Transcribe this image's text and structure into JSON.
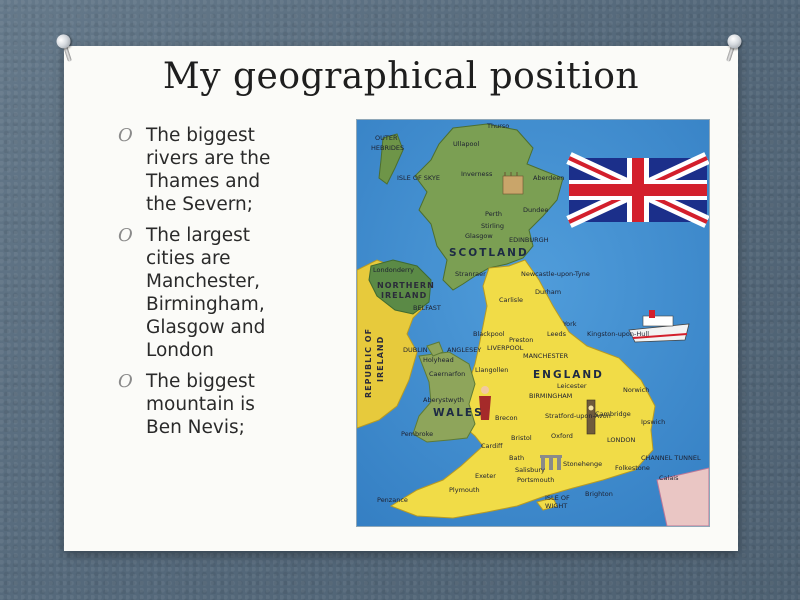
{
  "slide": {
    "title": "My geographical position",
    "bullets": [
      {
        "marker": "O",
        "text": "The biggest rivers are the Thames and the Severn;"
      },
      {
        "marker": "O",
        "text": "The largest cities are Manchester, Birmingham, Glasgow and London"
      },
      {
        "marker": "O",
        "text": "The biggest mountain is Ben Nevis;"
      }
    ]
  },
  "map": {
    "regions": {
      "scotland": "SCOTLAND",
      "england": "ENGLAND",
      "wales": "WALES",
      "northern_ireland_1": "NORTHERN",
      "northern_ireland_2": "IRELAND",
      "republic_1": "REPUBLIC OF",
      "republic_2": "IRELAND"
    },
    "places": {
      "thurso": "Thurso",
      "ullapool": "Ullapool",
      "outer_hebrides_1": "OUTER",
      "outer_hebrides_2": "HEBRIDES",
      "isle_of_skye": "ISLE OF SKYE",
      "inverness": "Inverness",
      "aberdeen": "Aberdeen",
      "dundee": "Dundee",
      "perth": "Perth",
      "stirling": "Stirling",
      "glasgow": "Glasgow",
      "edinburgh": "EDINBURGH",
      "stranraer": "Stranraer",
      "londonderry": "Londonderry",
      "belfast": "BELFAST",
      "newcastle": "Newcastle-upon-Tyne",
      "durham": "Durham",
      "carlisle": "Carlisle",
      "york": "York",
      "hull": "Kingston-upon-Hull",
      "blackpool": "Blackpool",
      "preston": "Preston",
      "leeds": "Leeds",
      "liverpool": "LIVERPOOL",
      "manchester": "MANCHESTER",
      "dublin": "DUBLIN",
      "holyhead": "Holyhead",
      "anglesey": "ANGLESEY",
      "caernarfon": "Caernarfon",
      "llangollen": "Llangollen",
      "leicester": "Leicester",
      "norwich": "Norwich",
      "birmingham": "BIRMINGHAM",
      "aberystwyth": "Aberystwyth",
      "stratford": "Stratford-upon-Avon",
      "cambridge": "Cambridge",
      "ipswich": "Ipswich",
      "pembroke": "Pembroke",
      "brecon": "Brecon",
      "oxford": "Oxford",
      "cardiff": "Cardiff",
      "bristol": "Bristol",
      "london": "LONDON",
      "bath": "Bath",
      "stonehenge": "Stonehenge",
      "salisbury": "Salisbury",
      "folkestone": "Folkestone",
      "calais": "Calais",
      "tunnel": "CHANNEL TUNNEL",
      "exeter": "Exeter",
      "portsmouth": "Portsmouth",
      "plymouth": "Plymouth",
      "brighton": "Brighton",
      "isle_of_wight_1": "ISLE OF",
      "isle_of_wight_2": "WIGHT",
      "penzance": "Penzance"
    },
    "colors": {
      "sea": "#3f8fd2",
      "gb_land": "#f1dc47",
      "scotland_land": "#7b9f53",
      "ireland_land": "#e7ca3c",
      "wales_land": "#8ea55b"
    }
  }
}
